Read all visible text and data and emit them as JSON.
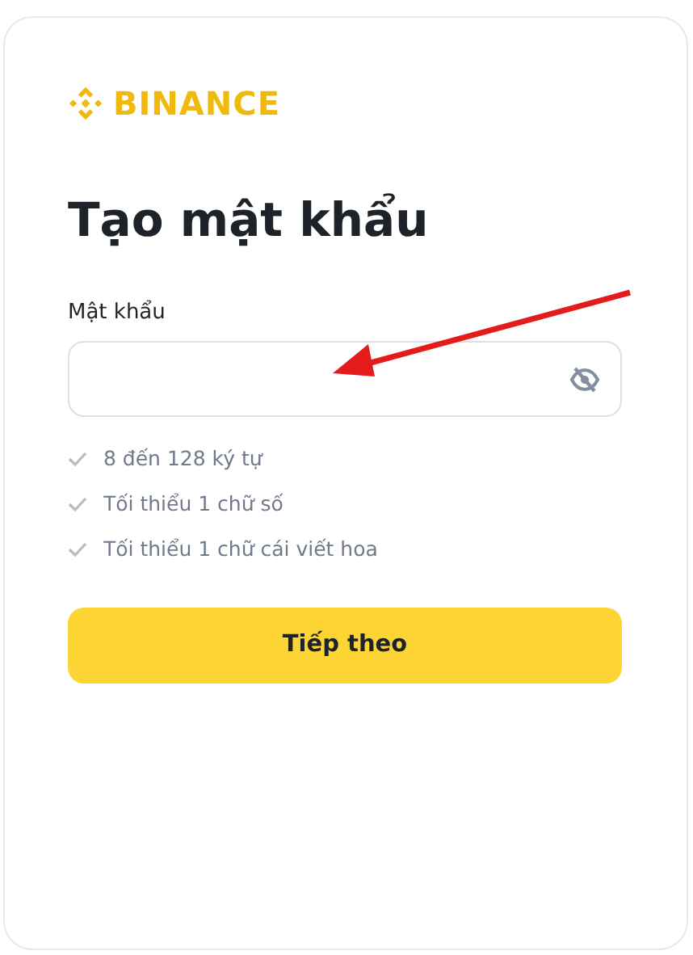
{
  "logo": {
    "text": "BINANCE"
  },
  "title": "Tạo mật khẩu",
  "password_field": {
    "label": "Mật khẩu",
    "visible": false
  },
  "rules": [
    {
      "text": "8 đến 128 ký tự",
      "met": false
    },
    {
      "text": "Tối thiểu 1 chữ số",
      "met": false
    },
    {
      "text": "Tối thiểu 1 chữ cái viết hoa",
      "met": false
    }
  ],
  "buttons": [
    {
      "label": "Tiếp theo"
    }
  ]
}
